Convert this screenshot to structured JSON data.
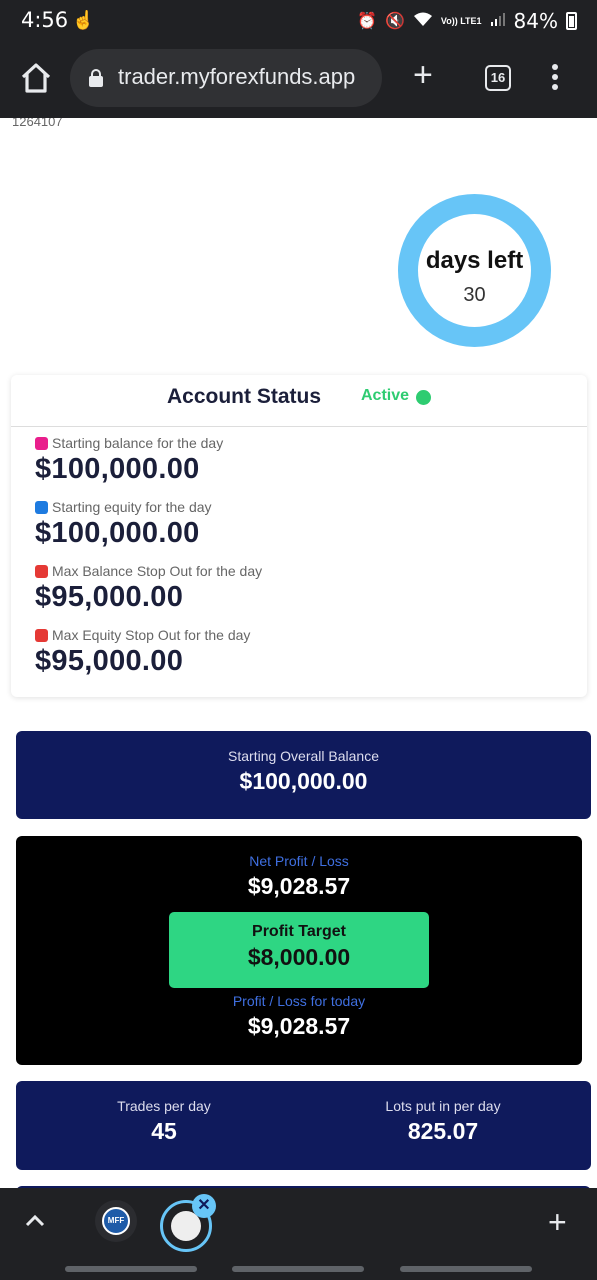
{
  "status_bar": {
    "time": "4:56",
    "battery": "84%",
    "network": "Vo)) LTE1"
  },
  "browser": {
    "url": "trader.myforexfunds.app",
    "tab_count": "16"
  },
  "page": {
    "account_id": "1264107",
    "days_left": {
      "label": "days left",
      "value": "30"
    },
    "account_status": {
      "title": "Account Status",
      "state": "Active",
      "metrics": [
        {
          "label": "Starting balance for the day",
          "value": "$100,000.00",
          "color": "#e91e8c"
        },
        {
          "label": "Starting equity for the day",
          "value": "$100,000.00",
          "color": "#1e7be0"
        },
        {
          "label": "Max Balance Stop Out for the day",
          "value": "$95,000.00",
          "color": "#e53935"
        },
        {
          "label": "Max Equity Stop Out for the day",
          "value": "$95,000.00",
          "color": "#e53935"
        }
      ]
    },
    "overall": {
      "label": "Starting Overall Balance",
      "value": "$100,000.00"
    },
    "profit": {
      "net_label": "Net Profit / Loss",
      "net_value": "$9,028.57",
      "target_label": "Profit Target",
      "target_value": "$8,000.00",
      "today_label": "Profit / Loss for today",
      "today_value": "$9,028.57"
    },
    "trades": {
      "trades_label": "Trades per day",
      "trades_value": "45",
      "lots_label": "Lots put in per day",
      "lots_value": "825.07"
    }
  },
  "colors": {
    "navy": "#0f1a5c",
    "ring": "#67c5f7",
    "active": "#2ecc71",
    "target": "#2ed683"
  }
}
